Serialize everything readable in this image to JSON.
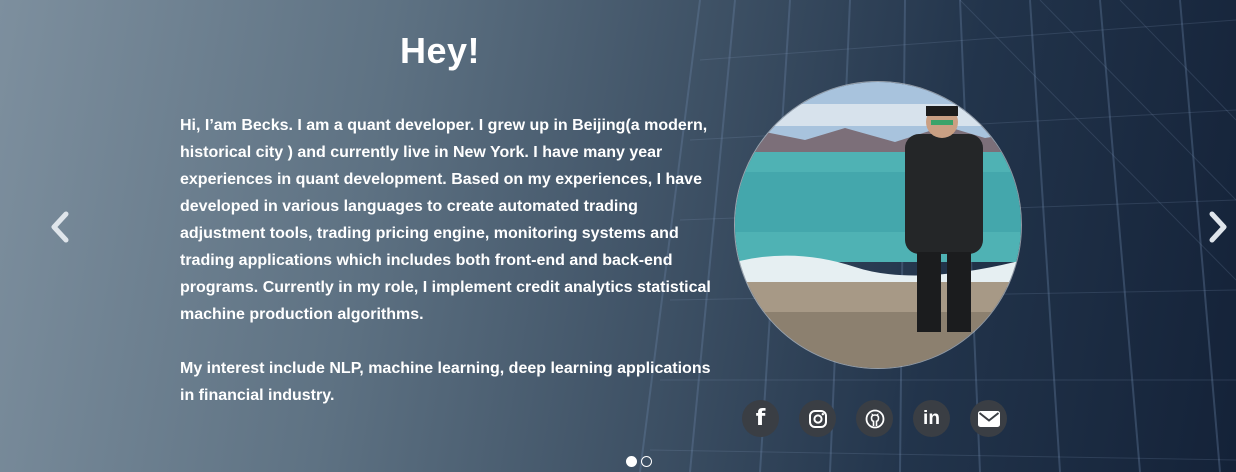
{
  "slide": {
    "title": "Hey!",
    "paragraphs": [
      "Hi, I’am Becks. I am a quant developer. I grew up in Beijing(a modern, historical city ) and currently live in New York. I have many year experiences in quant development. Based on my experiences, I have developed in various languages to create automated trading adjustment tools, trading pricing engine, monitoring systems and trading applications which includes both front-end and back-end programs. Currently in my role, I implement credit analytics statistical machine production algorithms.",
      "My interest include NLP, machine learning, deep learning applications in financial industry."
    ]
  },
  "controls": {
    "prev_icon": "chevron-left-icon",
    "next_icon": "chevron-right-icon"
  },
  "socials": [
    {
      "icon": "facebook-icon",
      "glyph": "f"
    },
    {
      "icon": "instagram-icon"
    },
    {
      "icon": "github-icon"
    },
    {
      "icon": "linkedin-icon",
      "glyph": "in"
    },
    {
      "icon": "envelope-icon"
    }
  ],
  "indicators": {
    "count": 2,
    "active": 1
  },
  "colors": {
    "social_bg": "#3a3e44",
    "text": "#ffffff",
    "bg_dark": "#142238",
    "bg_light": "#7d8f9e"
  }
}
